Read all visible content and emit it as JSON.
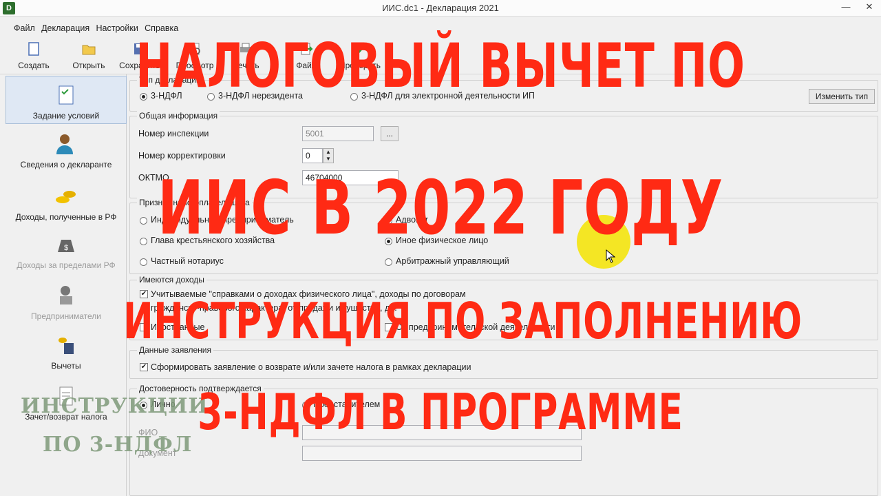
{
  "window": {
    "title": "ИИС.dc1 - Декларация 2021",
    "app_icon": "D"
  },
  "menu": [
    "Файл",
    "Декларация",
    "Настройки",
    "Справка"
  ],
  "toolbar": [
    "Создать",
    "Открыть",
    "Сохранить",
    "Просмотр",
    "Печать",
    "Файл",
    "Проверить"
  ],
  "sidebar": [
    {
      "label": "Задание условий",
      "icon": "checklist-icon",
      "selected": true
    },
    {
      "label": "Сведения о декларанте",
      "icon": "person-icon"
    },
    {
      "label": "Доходы, полученные в РФ",
      "icon": "coins-icon"
    },
    {
      "label": "Доходы за пределами РФ",
      "icon": "money-bag-icon",
      "disabled": true
    },
    {
      "label": "Предприниматели",
      "icon": "entrepreneur-icon",
      "disabled": true
    },
    {
      "label": "Вычеты",
      "icon": "calculator-icon"
    },
    {
      "label": "Зачет/возврат налога",
      "icon": "document-icon"
    }
  ],
  "form": {
    "decl_type_group": "Тип декларации",
    "decl_type_opt1": "3-НДФЛ",
    "decl_type_opt2": "3-НДФЛ нерезидента",
    "decl_type_opt3": "3-НДФЛ для электронной деятельности ИП",
    "change_type_btn": "Изменить тип",
    "general_group": "Общая информация",
    "inspection_label": "Номер инспекции",
    "inspection_value": "5001",
    "browse_btn": "...",
    "correction_label": "Номер корректировки",
    "correction_value": "0",
    "oktmo_label": "ОКТМО",
    "oktmo_value": "46704000",
    "taxpayer_group": "Признак налогоплательщика",
    "tp_opt1": "Индивидуальный предприниматель",
    "tp_opt2": "Глава крестьянского хозяйства",
    "tp_opt3": "Частный нотариус",
    "tp_opt4": "Адвокат",
    "tp_opt5": "Иное физическое лицо",
    "tp_opt6": "Арбитражный управляющий",
    "income_group": "Имеются доходы",
    "income_chk1": "Учитываемые \"справками о доходах физического лица\", доходы по договорам",
    "income_chk1b": "гражданско-правового характера, от продажи имущества, др.",
    "income_chk2": "Иностранные",
    "income_chk3": "От предпринимательской деятельности",
    "app_group": "Данные заявления",
    "app_chk": "Сформировать заявление о  возврате и/или зачете налога в рамках декларации",
    "conf_group": "Достоверность подтверждается",
    "conf_opt1": "Лично",
    "conf_opt2": "Представителем",
    "fio_label": "ФИО",
    "doc_label": "Документ"
  },
  "overlay": {
    "line1": "НАЛОГОВЫЙ ВЫЧЕТ ПО",
    "line2": "ИИС В 2022 ГОДУ",
    "line3": "ИНСТРУКЦИЯ ПО ЗАПОЛНЕНИЮ",
    "line4": "3-НДФЛ В ПРОГРАММЕ",
    "color": "#ff2a14"
  },
  "watermark": {
    "line1": "ИНСТРУКЦИИ",
    "line2": "ПО 3-НДФЛ"
  }
}
